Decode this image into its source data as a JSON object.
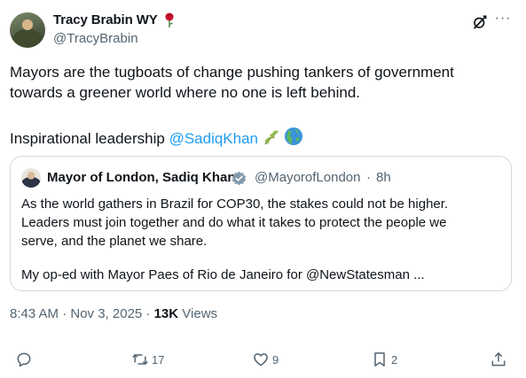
{
  "author": {
    "name": "Tracy Brabin WY",
    "handle": "@TracyBrabin",
    "name_emoji": "rose-icon"
  },
  "header_icons": [
    "grok-icon",
    "more-icon"
  ],
  "more_label": "···",
  "body": {
    "line1": "Mayors are the tugboats of change pushing tankers of government",
    "line2": "towards a greener world where no one is left behind.",
    "line3_prefix": "Inspirational leadership ",
    "mention": "@SadiqKhan",
    "trailing_emoji": [
      "herb-icon",
      "globe-americas-icon"
    ]
  },
  "quote": {
    "name": "Mayor of London, Sadiq Khan",
    "handle": "@MayorofLondon",
    "separator": "·",
    "time": "8h",
    "verified": true,
    "line1": "As the world gathers in Brazil for COP30, the stakes could not be higher.",
    "line2": "Leaders must join together and do what it takes to protect the people we",
    "line3": "serve, and the planet we share.",
    "line4": "My op-ed with Mayor Paes of Rio de Janeiro for @NewStatesman  ..."
  },
  "meta": {
    "timestamp": "8:43 AM · Nov 3, 2025 · ",
    "views_count": "13K",
    "views_label": " Views"
  },
  "actions": {
    "reply": {
      "icon": "reply-icon",
      "count": ""
    },
    "repost": {
      "icon": "repost-icon",
      "count": "17"
    },
    "like": {
      "icon": "heart-icon",
      "count": "9"
    },
    "bookmark": {
      "icon": "bookmark-icon",
      "count": "2"
    },
    "share": {
      "icon": "share-icon",
      "count": ""
    }
  },
  "colors": {
    "text": "#0f1419",
    "secondary": "#536471",
    "link": "#1d9bf0",
    "border": "#cfd9de",
    "verified": "#829aab"
  }
}
